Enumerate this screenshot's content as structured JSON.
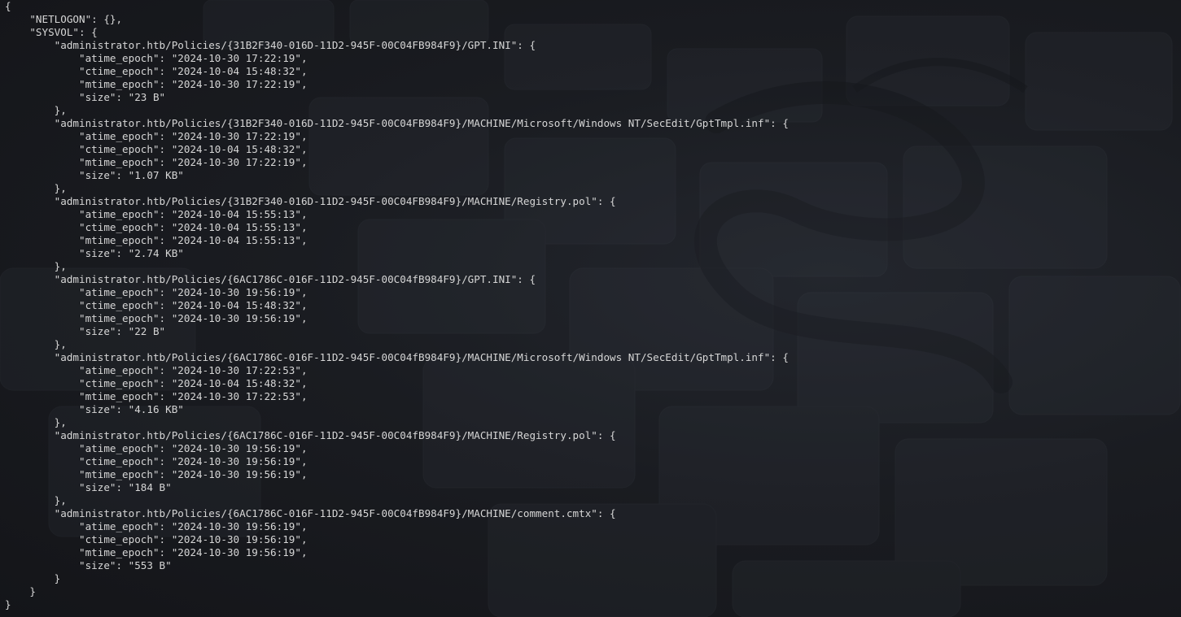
{
  "terminal": {
    "lines": [
      "{",
      "    \"NETLOGON\": {},",
      "    \"SYSVOL\": {",
      "        \"administrator.htb/Policies/{31B2F340-016D-11D2-945F-00C04FB984F9}/GPT.INI\": {",
      "            \"atime_epoch\": \"2024-10-30 17:22:19\",",
      "            \"ctime_epoch\": \"2024-10-04 15:48:32\",",
      "            \"mtime_epoch\": \"2024-10-30 17:22:19\",",
      "            \"size\": \"23 B\"",
      "        },",
      "        \"administrator.htb/Policies/{31B2F340-016D-11D2-945F-00C04FB984F9}/MACHINE/Microsoft/Windows NT/SecEdit/GptTmpl.inf\": {",
      "            \"atime_epoch\": \"2024-10-30 17:22:19\",",
      "            \"ctime_epoch\": \"2024-10-04 15:48:32\",",
      "            \"mtime_epoch\": \"2024-10-30 17:22:19\",",
      "            \"size\": \"1.07 KB\"",
      "        },",
      "        \"administrator.htb/Policies/{31B2F340-016D-11D2-945F-00C04FB984F9}/MACHINE/Registry.pol\": {",
      "            \"atime_epoch\": \"2024-10-04 15:55:13\",",
      "            \"ctime_epoch\": \"2024-10-04 15:55:13\",",
      "            \"mtime_epoch\": \"2024-10-04 15:55:13\",",
      "            \"size\": \"2.74 KB\"",
      "        },",
      "        \"administrator.htb/Policies/{6AC1786C-016F-11D2-945F-00C04fB984F9}/GPT.INI\": {",
      "            \"atime_epoch\": \"2024-10-30 19:56:19\",",
      "            \"ctime_epoch\": \"2024-10-04 15:48:32\",",
      "            \"mtime_epoch\": \"2024-10-30 19:56:19\",",
      "            \"size\": \"22 B\"",
      "        },",
      "        \"administrator.htb/Policies/{6AC1786C-016F-11D2-945F-00C04fB984F9}/MACHINE/Microsoft/Windows NT/SecEdit/GptTmpl.inf\": {",
      "            \"atime_epoch\": \"2024-10-30 17:22:53\",",
      "            \"ctime_epoch\": \"2024-10-04 15:48:32\",",
      "            \"mtime_epoch\": \"2024-10-30 17:22:53\",",
      "            \"size\": \"4.16 KB\"",
      "        },",
      "        \"administrator.htb/Policies/{6AC1786C-016F-11D2-945F-00C04fB984F9}/MACHINE/Registry.pol\": {",
      "            \"atime_epoch\": \"2024-10-30 19:56:19\",",
      "            \"ctime_epoch\": \"2024-10-30 19:56:19\",",
      "            \"mtime_epoch\": \"2024-10-30 19:56:19\",",
      "            \"size\": \"184 B\"",
      "        },",
      "        \"administrator.htb/Policies/{6AC1786C-016F-11D2-945F-00C04fB984F9}/MACHINE/comment.cmtx\": {",
      "            \"atime_epoch\": \"2024-10-30 19:56:19\",",
      "            \"ctime_epoch\": \"2024-10-30 19:56:19\",",
      "            \"mtime_epoch\": \"2024-10-30 19:56:19\",",
      "            \"size\": \"553 B\"",
      "        }",
      "    }",
      "}"
    ]
  }
}
